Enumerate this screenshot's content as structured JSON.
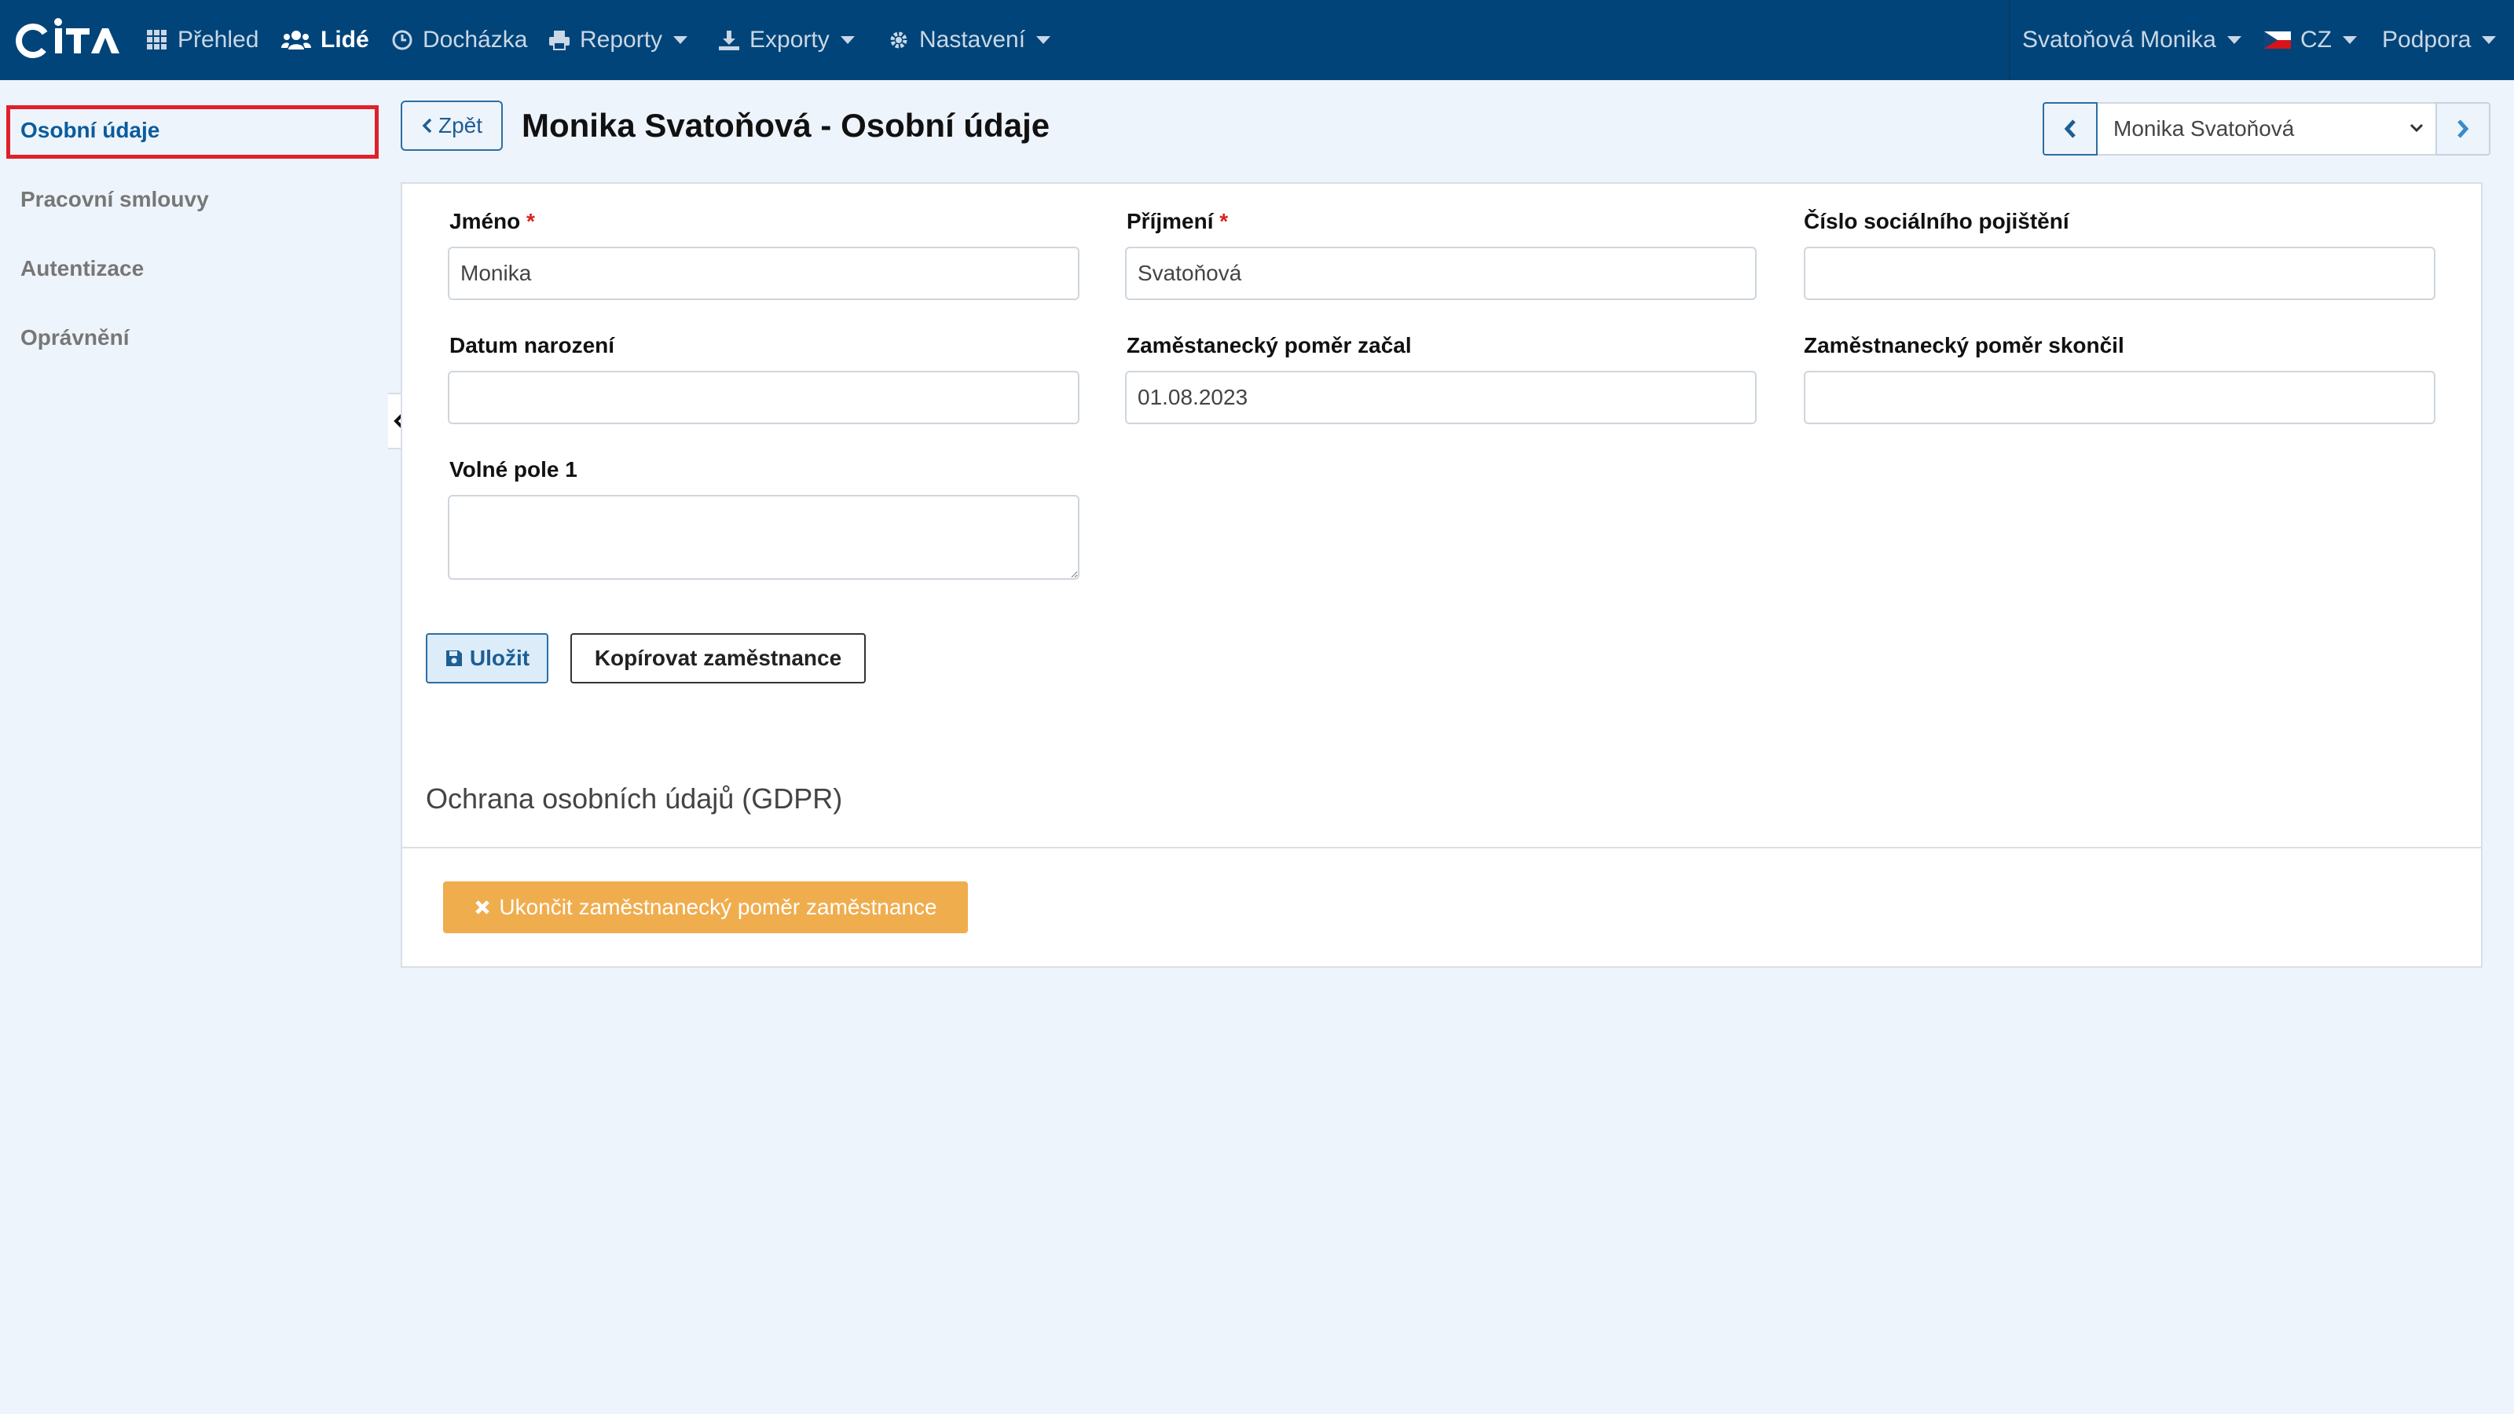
{
  "navbar": {
    "logo_text": "CiTA",
    "items": [
      {
        "label": "Přehled",
        "icon": "grid-icon"
      },
      {
        "label": "Lidé",
        "icon": "users-icon",
        "active": true
      },
      {
        "label": "Docházka",
        "icon": "clock-icon"
      },
      {
        "label": "Reporty",
        "icon": "print-icon",
        "dropdown": true
      },
      {
        "label": "Exporty",
        "icon": "export-icon",
        "dropdown": true
      },
      {
        "label": "Nastavení",
        "icon": "gear-icon",
        "dropdown": true
      }
    ],
    "user": "Svatoňová Monika",
    "language": "CZ",
    "support": "Podpora"
  },
  "sidebar": {
    "items": [
      {
        "label": "Osobní údaje",
        "active": true
      },
      {
        "label": "Pracovní smlouvy"
      },
      {
        "label": "Autentizace"
      },
      {
        "label": "Oprávnění"
      }
    ]
  },
  "header": {
    "back_label": "Zpět",
    "title": "Monika Svatoňová - Osobní údaje",
    "employee_selected": "Monika Svatoňová"
  },
  "form": {
    "first_name": {
      "label": "Jméno",
      "required_mark": "*",
      "value": "Monika"
    },
    "last_name": {
      "label": "Příjmení",
      "required_mark": "*",
      "value": "Svatoňová"
    },
    "insurance_number": {
      "label": "Číslo sociálního pojištění",
      "value": ""
    },
    "birth_date": {
      "label": "Datum narození",
      "value": ""
    },
    "employment_start": {
      "label": "Zaměstanecký poměr začal",
      "value": "01.08.2023"
    },
    "employment_end": {
      "label": "Zaměstnanecký poměr skončil",
      "value": ""
    },
    "free_field_1": {
      "label": "Volné pole 1",
      "value": ""
    },
    "save_label": "Uložit",
    "copy_label": "Kopírovat zaměstnance"
  },
  "gdpr": {
    "title": "Ochrana osobních údajů (GDPR)",
    "end_employment_label": "Ukončit zaměstnanecký poměr zaměstnance"
  },
  "colors": {
    "navbar_bg": "#004479",
    "accent": "#1d5e94",
    "warning": "#f0ad4e",
    "highlight": "#e0202a"
  }
}
